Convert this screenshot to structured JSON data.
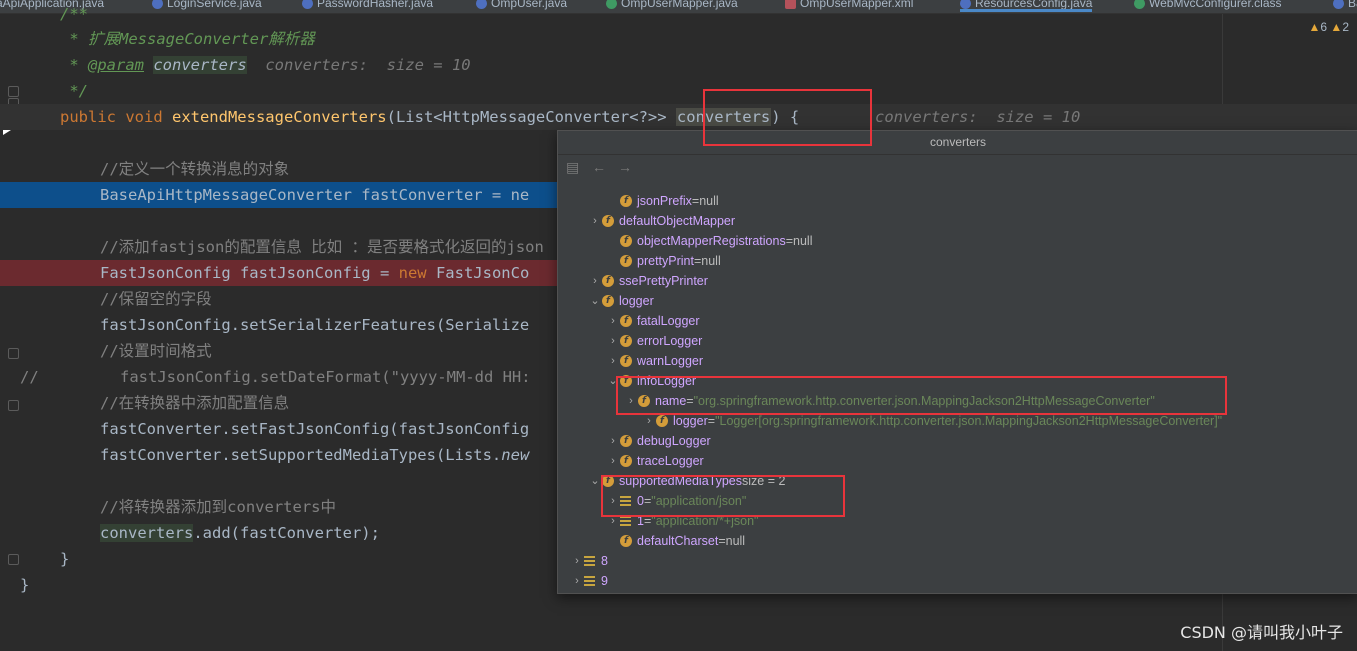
{
  "tabs": [
    {
      "label": "aApiApplication.java",
      "icon": "class-icon"
    },
    {
      "label": "LoginService.java",
      "icon": "class-icon"
    },
    {
      "label": "PasswordHasher.java",
      "icon": "class-icon"
    },
    {
      "label": "OmpUser.java",
      "icon": "class-icon"
    },
    {
      "label": "OmpUserMapper.java",
      "icon": "interface-icon"
    },
    {
      "label": "OmpUserMapper.xml",
      "icon": "xml-icon"
    },
    {
      "label": "ResourcesConfig.java",
      "icon": "class-icon"
    },
    {
      "label": "WebMvcConfigurer.class",
      "icon": "interface-icon"
    },
    {
      "label": "Ba",
      "icon": "class-icon"
    }
  ],
  "inspection": {
    "warnings": "6",
    "more": "2"
  },
  "code": {
    "l1": "/**",
    "l2a": " * 扩展MessageConverter解析器",
    "l3_star": " * ",
    "l3_tag": "@param",
    "l3_param": "converters",
    "l3_hint": "  converters:  size = 10",
    "l4": " */",
    "l5_kw": "public void ",
    "l5_fn": "extendMessageConverters",
    "l5_mid": "(List<HttpMessageConverter<?>> ",
    "l5_sel": "converters",
    "l5_end": ") {",
    "l5_hint": "converters:  size = 10",
    "l7": "//定义一个转换消息的对象",
    "l8": "BaseApiHttpMessageConverter fastConverter = ne",
    "l10": "//添加fastjson的配置信息 比如 ：是否要格式化返回的json",
    "l11a": "FastJsonConfig fastJsonConfig = ",
    "l11kw": "new",
    "l11b": " FastJsonCo",
    "l12": "//保留空的字段",
    "l13": "fastJsonConfig.setSerializerFeatures(Serialize",
    "l14": "//设置时间格式",
    "l15a": "//",
    "l15b": "fastJsonConfig.setDateFormat(\"yyyy-MM-dd HH:",
    "l16": "//在转换器中添加配置信息",
    "l17": "fastConverter.setFastJsonConfig(fastJsonConfig",
    "l18a": "fastConverter.setSupportedMediaTypes(Lists.",
    "l18b": "new",
    "l20": "//将转换器添加到converters中",
    "l21a": "converters",
    "l21b": ".add(fastConverter);",
    "l22": "}",
    "l23": "}"
  },
  "popup": {
    "title": "converters",
    "tools": {
      "back": "←",
      "forward": "→"
    },
    "nodes": [
      {
        "name": "jsonPrefix",
        "eq": " = ",
        "val": "null"
      },
      {
        "name": "defaultObjectMapper",
        "eq": "",
        "val": ""
      },
      {
        "name": "objectMapperRegistrations",
        "eq": " = ",
        "val": "null"
      },
      {
        "name": "prettyPrint",
        "eq": " = ",
        "val": "null"
      },
      {
        "name": "ssePrettyPrinter",
        "eq": "",
        "val": ""
      },
      {
        "name": "logger",
        "eq": "",
        "val": ""
      },
      {
        "name": "fatalLogger",
        "eq": "",
        "val": ""
      },
      {
        "name": "errorLogger",
        "eq": "",
        "val": ""
      },
      {
        "name": "warnLogger",
        "eq": "",
        "val": ""
      },
      {
        "name": "infoLogger",
        "eq": "",
        "val": ""
      },
      {
        "name": "name",
        "eq": " = ",
        "val": "\"org.springframework.http.converter.json.MappingJackson2HttpMessageConverter\""
      },
      {
        "name": "logger",
        "eq": " = ",
        "val": "\"Logger[org.springframework.http.converter.json.MappingJackson2HttpMessageConverter]\""
      },
      {
        "name": "debugLogger",
        "eq": "",
        "val": ""
      },
      {
        "name": "traceLogger",
        "eq": "",
        "val": ""
      },
      {
        "name": "supportedMediaTypes",
        "eq": "  size = 2",
        "val": ""
      },
      {
        "name": "0",
        "eq": " = ",
        "val": "\"application/json\""
      },
      {
        "name": "1",
        "eq": " = ",
        "val": "\"application/*+json\""
      },
      {
        "name": "defaultCharset",
        "eq": " = ",
        "val": "null"
      },
      {
        "name": "8",
        "eq": "",
        "val": ""
      },
      {
        "name": "9",
        "eq": "",
        "val": ""
      }
    ]
  },
  "watermark": "CSDN @请叫我小叶子",
  "colors": {
    "highlight_box": "#e8343b",
    "selection_blue": "#0d4f8b",
    "breakpoint_red": "#6b2a2f"
  }
}
